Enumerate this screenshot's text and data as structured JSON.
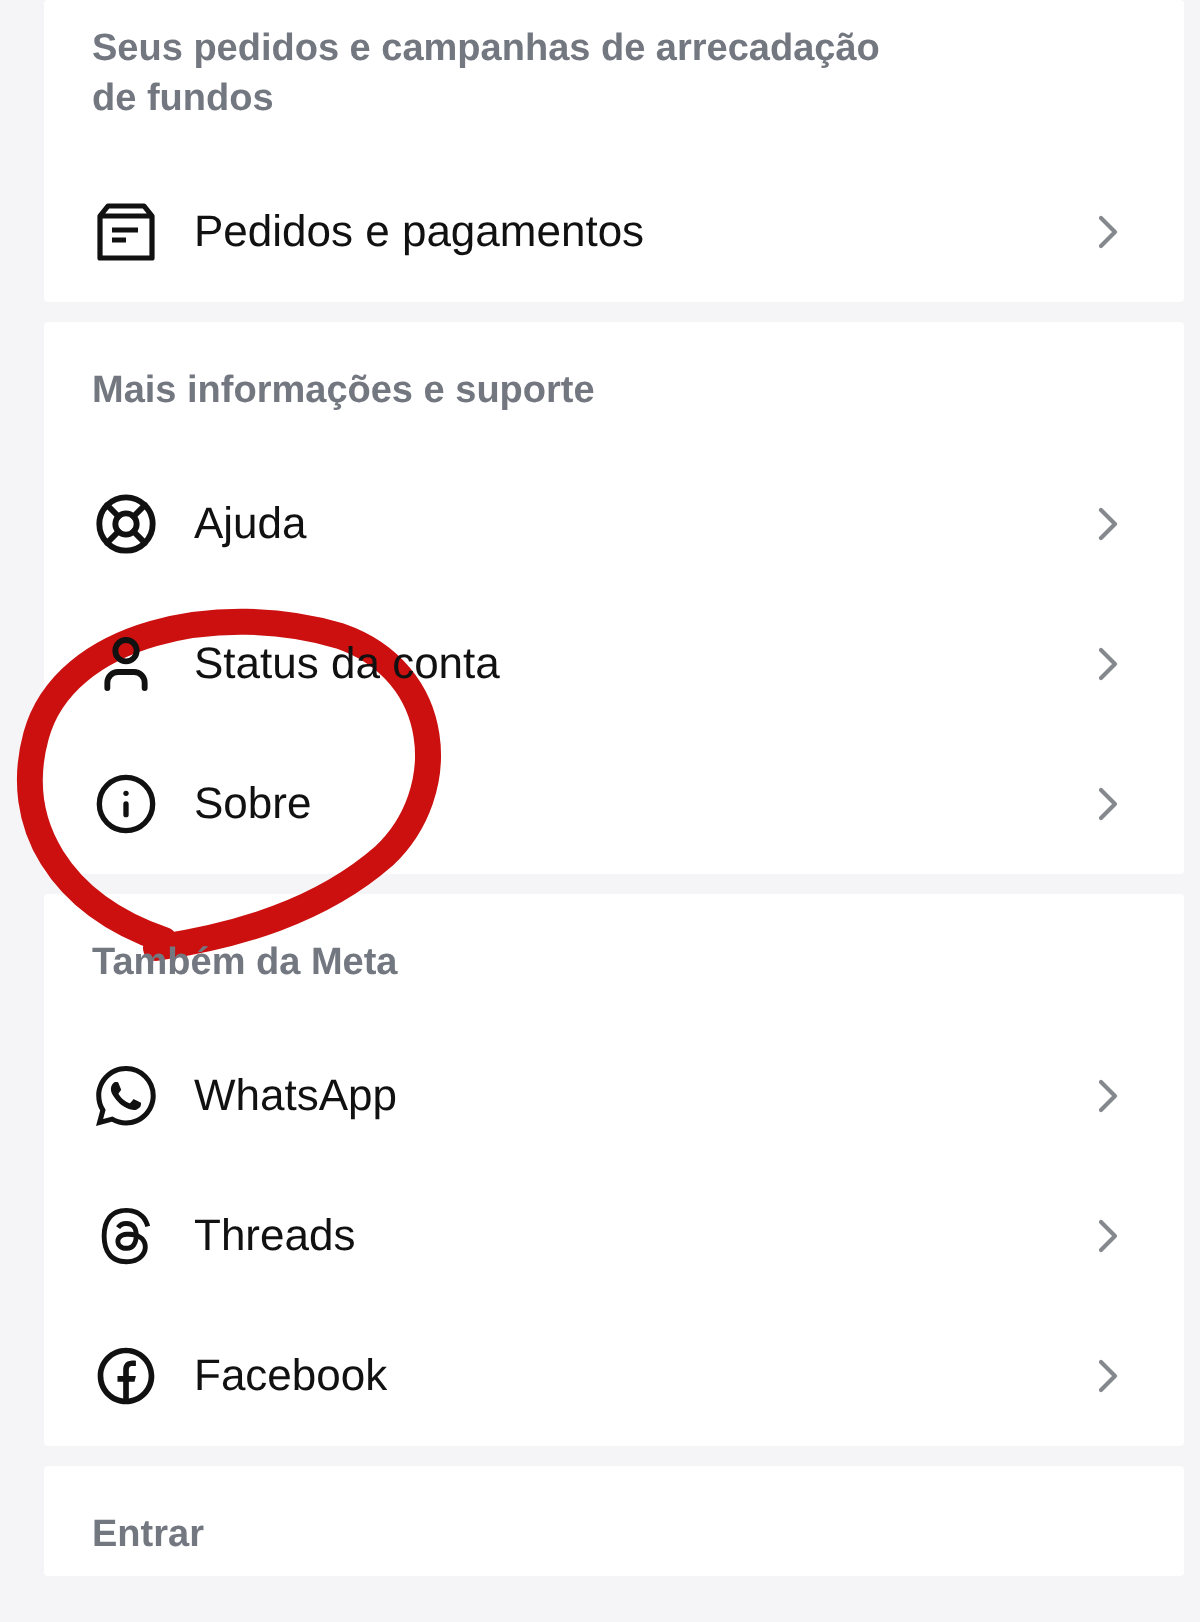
{
  "sections": [
    {
      "header": "Seus pedidos e campanhas de arrecadação de fundos",
      "items": [
        {
          "kind": "orders",
          "label": "Pedidos e pagamentos"
        }
      ]
    },
    {
      "header": "Mais informações e suporte",
      "items": [
        {
          "kind": "help",
          "label": "Ajuda"
        },
        {
          "kind": "account",
          "label": "Status da conta"
        },
        {
          "kind": "about",
          "label": "Sobre"
        }
      ]
    },
    {
      "header": "Também da Meta",
      "items": [
        {
          "kind": "whatsapp",
          "label": "WhatsApp"
        },
        {
          "kind": "threads",
          "label": "Threads"
        },
        {
          "kind": "facebook",
          "label": "Facebook"
        }
      ]
    },
    {
      "header": "Entrar"
    }
  ],
  "annotation": {
    "kind": "circle",
    "color": "#cc1010"
  }
}
